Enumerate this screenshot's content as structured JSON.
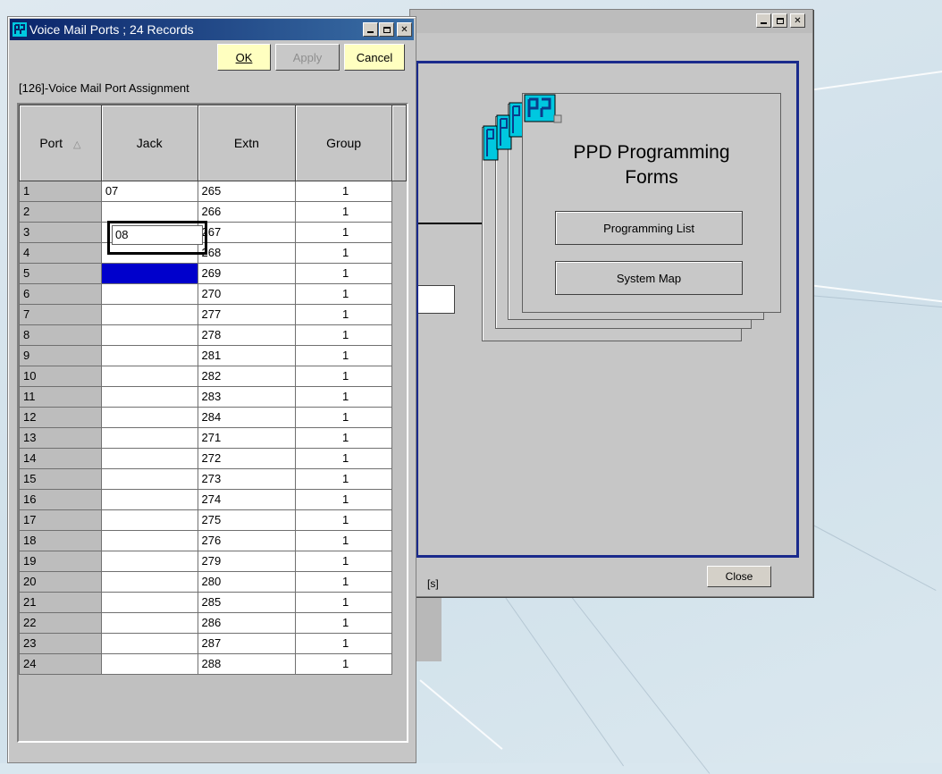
{
  "back_window": {
    "panel_text": "[s]",
    "close_label": "Close",
    "card_title_line1": "PPD Programming",
    "card_title_line2": "Forms",
    "programming_list_label": "Programming List",
    "system_map_label": "System Map"
  },
  "voice_mail": {
    "title": "Voice Mail Ports ; 24 Records",
    "ok_label": "OK",
    "apply_label": "Apply",
    "cancel_label": "Cancel",
    "subtitle": "[126]-Voice Mail Port Assignment",
    "columns": {
      "port": "Port",
      "jack": "Jack",
      "extn": "Extn",
      "group": "Group"
    },
    "editor_value": "08",
    "rows": [
      {
        "port": "1",
        "jack": "07",
        "extn": "265",
        "group": "1"
      },
      {
        "port": "2",
        "jack": "",
        "extn": "266",
        "group": "1"
      },
      {
        "port": "3",
        "jack": "",
        "extn": "267",
        "group": "1"
      },
      {
        "port": "4",
        "jack": "",
        "extn": "268",
        "group": "1"
      },
      {
        "port": "5",
        "jack": "",
        "extn": "269",
        "group": "1"
      },
      {
        "port": "6",
        "jack": "",
        "extn": "270",
        "group": "1"
      },
      {
        "port": "7",
        "jack": "",
        "extn": "277",
        "group": "1"
      },
      {
        "port": "8",
        "jack": "",
        "extn": "278",
        "group": "1"
      },
      {
        "port": "9",
        "jack": "",
        "extn": "281",
        "group": "1"
      },
      {
        "port": "10",
        "jack": "",
        "extn": "282",
        "group": "1"
      },
      {
        "port": "11",
        "jack": "",
        "extn": "283",
        "group": "1"
      },
      {
        "port": "12",
        "jack": "",
        "extn": "284",
        "group": "1"
      },
      {
        "port": "13",
        "jack": "",
        "extn": "271",
        "group": "1"
      },
      {
        "port": "14",
        "jack": "",
        "extn": "272",
        "group": "1"
      },
      {
        "port": "15",
        "jack": "",
        "extn": "273",
        "group": "1"
      },
      {
        "port": "16",
        "jack": "",
        "extn": "274",
        "group": "1"
      },
      {
        "port": "17",
        "jack": "",
        "extn": "275",
        "group": "1"
      },
      {
        "port": "18",
        "jack": "",
        "extn": "276",
        "group": "1"
      },
      {
        "port": "19",
        "jack": "",
        "extn": "279",
        "group": "1"
      },
      {
        "port": "20",
        "jack": "",
        "extn": "280",
        "group": "1"
      },
      {
        "port": "21",
        "jack": "",
        "extn": "285",
        "group": "1"
      },
      {
        "port": "22",
        "jack": "",
        "extn": "286",
        "group": "1"
      },
      {
        "port": "23",
        "jack": "",
        "extn": "287",
        "group": "1"
      },
      {
        "port": "24",
        "jack": "",
        "extn": "288",
        "group": "1"
      }
    ]
  },
  "colors": {
    "title_bar": "#0a246a",
    "panel_border": "#1a2a8c",
    "selected_cell": "#0000cc",
    "button_highlight": "#ffffc0"
  }
}
